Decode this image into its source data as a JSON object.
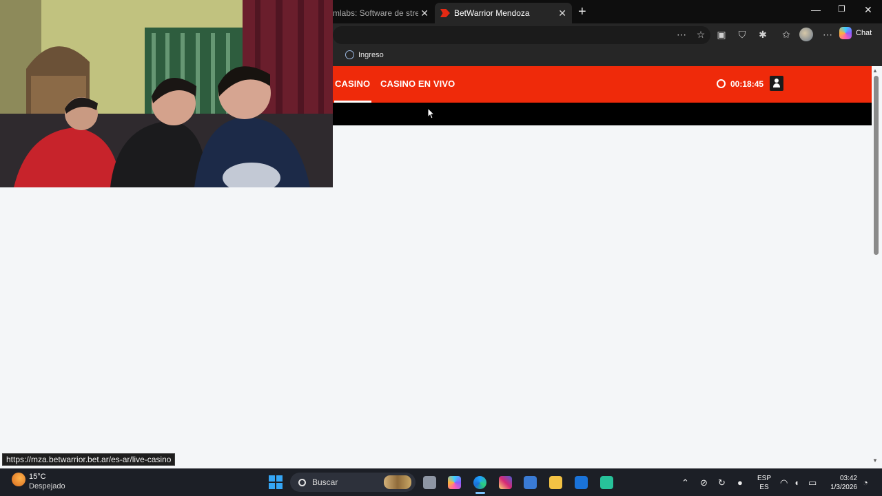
{
  "browser": {
    "tabs": [
      {
        "label": "mlabs: Software de streaming",
        "active": false
      },
      {
        "label": "BetWarrior Mendoza",
        "active": true
      }
    ],
    "bookmarks": [
      {
        "label": "Ingreso",
        "icon": "globe-icon"
      }
    ],
    "chat_label": "Chat",
    "status_url": "https://mza.betwarrior.bet.ar/es-ar/live-casino"
  },
  "site": {
    "brand_color": "#ef2a0a",
    "nav": [
      {
        "label": "CASINO",
        "active": true
      },
      {
        "label": "CASINO EN VIVO",
        "active": false
      }
    ],
    "session_timer": "00:18:45"
  },
  "taskbar": {
    "weather": {
      "temp": "15°C",
      "condition": "Despejado"
    },
    "search_placeholder": "Buscar",
    "language": {
      "line1": "ESP",
      "line2": "ES"
    },
    "clock": {
      "time": "03:42",
      "date": "1/3/2026"
    }
  }
}
